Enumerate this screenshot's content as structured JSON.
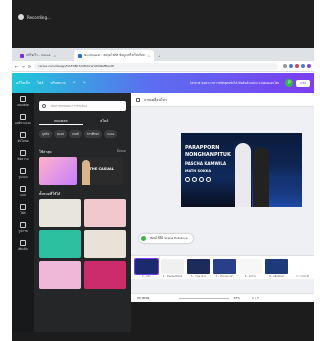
{
  "recording": {
    "label": "Recording..."
  },
  "browser": {
    "tabs": [
      {
        "label": "แก้ไขเร็ว – Canva"
      },
      {
        "label": "Nonthawat - ลดจุดโฟกัส ข้อมูลเสร็จเรียบร้อย"
      }
    ],
    "close_glyph": "×",
    "new_tab_glyph": "+",
    "address": "canva.com/design/DAFX8K7/Q8cDrwYWXNsfB/edit",
    "nav_glyphs": [
      "←",
      "→",
      "⟳"
    ]
  },
  "canva_top": {
    "menu": [
      "แก้ไขเล็ก",
      "ไฟล์",
      "ปรับขนาด"
    ],
    "undo_glyph": "↶",
    "redo_glyph": "↷",
    "title": "ไตรมาส คนหาง กล่าวหนักสุดหนักได้ ทันต้นน้ำแต่จบ แบบคนแอนโดร",
    "avatar_initial": "P",
    "share_label": "แชร์"
  },
  "rail": [
    "เทมเพลต",
    "องค์ประกอบ",
    "อัปโหลด",
    "ข้อความ",
    "รูปแบบ",
    "แอป",
    "ไฟล์",
    "รูปภาพ",
    "เพิ่มเติม"
  ],
  "panel": {
    "search_placeholder": "ค้นหาเทมเพลต การนำเสนอ",
    "tabs": [
      "เทมเพลต",
      "สไตล์"
    ],
    "chips": [
      "ธุรกิจ",
      "ละคร",
      "เกมส์",
      "การศึกษา",
      "Cute"
    ],
    "recent_label": "ใช้ล่าสุด",
    "recent_more": "ทั้งหมด",
    "featured_text": "THE CASUAL",
    "all_label": "ทั้งหมดที่ใช้ได้",
    "template_colors": [
      "#e8e5dd",
      "#f2c8cf",
      "#2cc0a0",
      "#e8e2d8",
      "#f0b8d8",
      "#cc2d6a"
    ]
  },
  "editor": {
    "toolbar_label": "ภาพเคลื่อนไหว",
    "slide": {
      "line1": "PARAPPORN",
      "line2": "NONGHANPITUK",
      "line3": "PASCHA KAMWILA",
      "line4": "MATH SOKKA"
    },
    "hint": "ซ่อนไว้ที่นี่ Scene Entrance",
    "pages": [
      {
        "label": "1 - หน้า"
      },
      {
        "label": "2 - ขั้นตอนนิวัฒน์"
      },
      {
        "label": "3 - กรุณาช่วย"
      },
      {
        "label": "4 - ปรับปรุงเวลา"
      },
      {
        "label": "5 - ค่าจ้าง"
      },
      {
        "label": "6 - ผลิตภัณฑ์"
      },
      {
        "label": "7 - กรรมาธิ"
      }
    ],
    "page_colors": [
      "#1a2a6c",
      "#f0f0f0",
      "#1c2b5a",
      "#2a3f8a",
      "#f7f7f7",
      "#1d3a7a",
      "#ffffff"
    ],
    "notes_label": "หมายเหตุ",
    "zoom": "33%",
    "page_count": "1 / 7"
  }
}
